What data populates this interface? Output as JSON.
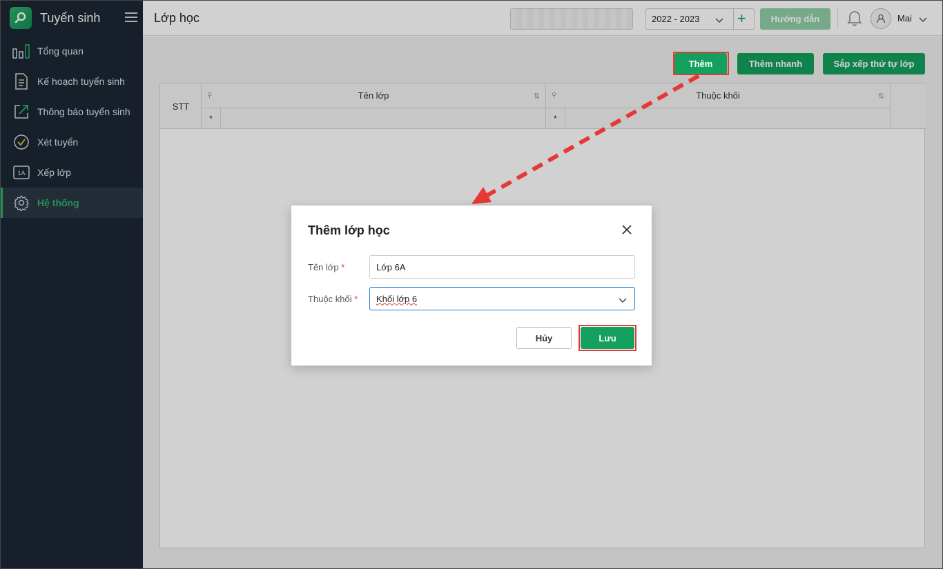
{
  "sidebar": {
    "brand": "Tuyển sinh",
    "items": [
      {
        "label": "Tổng quan",
        "icon": "bar-chart-icon"
      },
      {
        "label": "Kế hoạch tuyển sinh",
        "icon": "document-icon"
      },
      {
        "label": "Thông báo tuyển sinh",
        "icon": "external-link-icon"
      },
      {
        "label": "Xét tuyển",
        "icon": "check-circle-icon"
      },
      {
        "label": "Xếp lớp",
        "icon": "class-1a-icon",
        "badge": "1A"
      },
      {
        "label": "Hệ thống",
        "icon": "gear-icon",
        "active": true
      }
    ]
  },
  "header": {
    "title": "Lớp học",
    "year": "2022 - 2023",
    "guide_label": "Hướng dẫn",
    "user_name": "Mai"
  },
  "toolbar": {
    "add_label": "Thêm",
    "quick_add_label": "Thêm nhanh",
    "sort_label": "Sắp xếp thứ tự lớp"
  },
  "grid": {
    "columns": [
      "STT",
      "Tên lớp",
      "Thuộc khối"
    ],
    "filter_marker": "*"
  },
  "modal": {
    "title": "Thêm lớp học",
    "class_name_label": "Tên lớp",
    "class_name_value": "Lớp 6A",
    "grade_label": "Thuộc khối",
    "grade_value": "Khối lớp 6",
    "required_mark": "*",
    "cancel_label": "Hủy",
    "save_label": "Lưu"
  },
  "colors": {
    "accent": "#14a05e",
    "sidebar_bg": "#1d2834",
    "highlight": "#e53935"
  }
}
